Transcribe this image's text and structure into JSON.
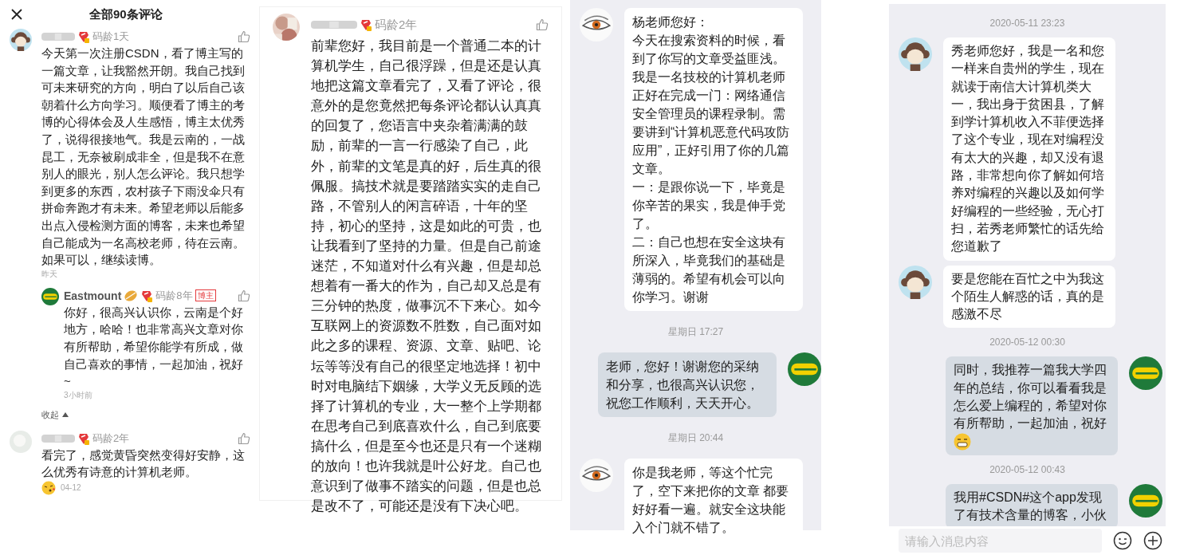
{
  "panels": [
    {
      "kind": "comments",
      "title": "全部90条评论",
      "comments": [
        {
          "kind": "monkey",
          "badge": "码龄1天",
          "text": "今天第一次注册CSDN，看了博主写的一篇文章，让我豁然开朗。我自己找到可未来研究的方向，明白了以后自己该朝着什么方向学习。顺便看了博主的考博的心得体会及人生感悟，博主太优秀了，说得很接地气。我是云南的，一战昆工，无奈被刷成非全，但是我不在意别人的眼光，别人怎么评论。我只想学到更多的东西，农村孩子下雨没伞只有拼命奔跑才有未来。希望老师以后能多出点入侵检测方面的博客，未来也希望自己能成为一名高校老师，待在云南。如果可以，继续读博。",
          "time": "昨天",
          "collapse": "收起",
          "replies": [
            {
              "kind": "logo",
              "name": "Eastmount",
              "medal": true,
              "badge": "码龄8年",
              "tag": "博主",
              "text": "你好，很高兴认识你，云南是个好地方，哈哈！也非常高兴文章对你有所帮助，希望你能学有所成，做自己喜欢的事情，一起加油，祝好~",
              "time": "3小时前"
            }
          ]
        },
        {
          "kind": "plain",
          "badge": "码龄2年",
          "text": "看完了，感觉黄昏突然变得好安静，这么优秀有诗意的计算机老师。",
          "emoji": true,
          "time": "04-12"
        }
      ]
    },
    {
      "kind": "comments",
      "comments": [
        {
          "badge": "码龄2年",
          "text": "前辈您好，我目前是一个普通二本的计算机学生，自己很浮躁，但是还是认真地把这篇文章看完了，又看了评论，很意外的是您竟然把每条评论都认认真真的回复了，您语言中夹杂着满满的鼓励，前辈的一言一行感染了自己，此外，前辈的文笔是真的好，后生真的很佩服。搞技术就是要踏踏实实的走自己路，不管别人的闲言碎语，十年的坚持，初心的坚持，这是如此的可贵，也让我看到了坚持的力量。但是自己前途迷茫，不知道对什么有兴趣，但是却总想着有一番大的作为，自己却又总是有三分钟的热度，做事沉不下来心。如今互联网上的资源数不胜数，自己面对如此之多的课程、资源、文章、贴吧、论坛等等没有自己的很坚定地选择！初中时对电脑结下姻缘，大学义无反顾的选择了计算机的专业，大一整个上学期都在思考自己到底喜欢什么，自己到底要搞什么，但是至今也还是只有一个迷糊的放向！也许我就是叶公好龙。自己也意识到了做事不踏实的问题，但是也总是改不了，可能还是没有下决心吧。"
        }
      ]
    },
    {
      "kind": "chat",
      "messages": [
        {
          "kind": "eye",
          "paragraphs": [
            "杨老师您好：",
            "今天在搜索资料的时候，看到了你写的文章受益匪浅。",
            "我是一名技校的计算机老师正好在完成一门：网络通信安全管理员的课程录制。需要讲到“计算机恶意代码攻防应用”，正好引用了你的几篇文章。",
            "一：是跟你说一下，毕竟是你辛苦的果实，我是伸手党了。",
            "二：自己也想在安全这块有所深入，毕竟我们的基础是薄弱的。希望有机会可以向你学习。谢谢"
          ]
        },
        {
          "kind": "time",
          "text": "星期日 17:27"
        },
        {
          "kind": "logo",
          "paragraphs": [
            "老师，您好！谢谢您的采纳和分享，也很高兴认识您，祝您工作顺利，天天开心。"
          ]
        },
        {
          "kind": "time",
          "text": "星期日 20:44"
        },
        {
          "kind": "eye",
          "paragraphs": [
            "你是我老师，等这个忙完了，空下来把你的文章 都要好好看一遍。就安全这块能入个门就不错了。"
          ]
        }
      ]
    },
    {
      "kind": "chat",
      "messages": [
        {
          "kind": "time",
          "text": "2020-05-11 23:23"
        },
        {
          "kind": "monkey",
          "paragraphs": [
            "秀老师您好，我是一名和您一样来自贵州的学生，现在就读于南信大计算机类大一，我出身于贫困县，了解到学计算机收入不菲便选择了这个专业，现在对编程没有太大的兴趣，却又没有退路，非常想向你了解如何培养对编程的兴趣以及如何学好编程的一些经验，无心打扫，若秀老师繁忙的话先给您道歉了"
          ]
        },
        {
          "kind": "monkey",
          "paragraphs": [
            "要是您能在百忙之中为我这个陌生人解惑的话，真的是感激不尽"
          ]
        },
        {
          "kind": "time",
          "text": "2020-05-12 00:30"
        },
        {
          "kind": "logo",
          "paragraphs": [
            "同时，我推荐一篇我大学四年的总结，你可以看看我是怎么爱上编程的，希望对你有所帮助，一起加油，祝好"
          ],
          "emoji": true
        },
        {
          "kind": "time",
          "text": "2020-05-12 00:43"
        },
        {
          "kind": "logo",
          "paragraphs": [
            "我用#CSDN#这个app发现了有技术含量的博客，小伙"
          ]
        }
      ],
      "input": {
        "placeholder": "请输入消息内容"
      }
    }
  ]
}
